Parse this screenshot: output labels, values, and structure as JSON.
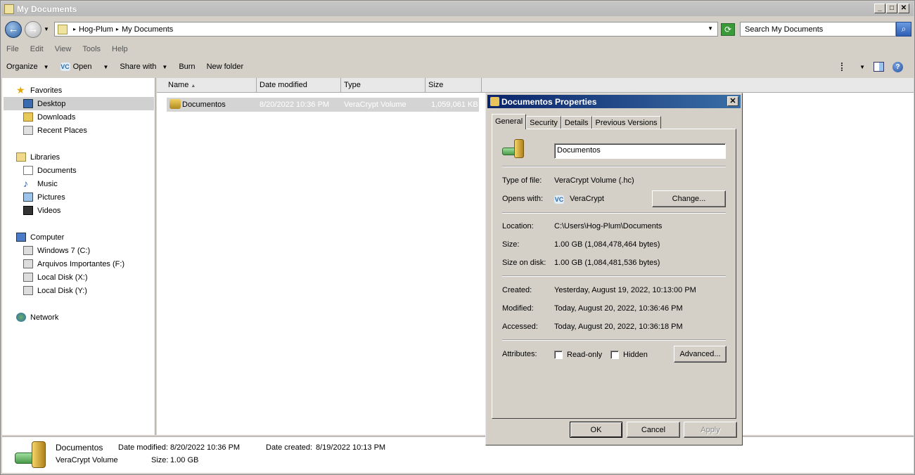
{
  "window": {
    "title": "My Documents"
  },
  "address": {
    "crumbs": [
      "Hog-Plum",
      "My Documents"
    ],
    "search_placeholder": "Search My Documents"
  },
  "menu": [
    "File",
    "Edit",
    "View",
    "Tools",
    "Help"
  ],
  "toolbar": {
    "organize": "Organize",
    "open": "Open",
    "share": "Share with",
    "burn": "Burn",
    "newfolder": "New folder"
  },
  "nav": {
    "favorites": "Favorites",
    "desktop": "Desktop",
    "downloads": "Downloads",
    "recent": "Recent Places",
    "libraries": "Libraries",
    "documents": "Documents",
    "music": "Music",
    "pictures": "Pictures",
    "videos": "Videos",
    "computer": "Computer",
    "drive_c": "Windows 7 (C:)",
    "drive_f": "Arquivos Importantes (F:)",
    "drive_x": "Local Disk (X:)",
    "drive_y": "Local Disk (Y:)",
    "network": "Network"
  },
  "columns": {
    "name": "Name",
    "date": "Date modified",
    "type": "Type",
    "size": "Size"
  },
  "file": {
    "name": "Documentos",
    "date": "8/20/2022 10:36 PM",
    "type": "VeraCrypt Volume",
    "size": "1,059,061 KB"
  },
  "status": {
    "name": "Documentos",
    "type": "VeraCrypt Volume",
    "date_modified_label": "Date modified:",
    "date_modified": "8/20/2022 10:36 PM",
    "date_created_label": "Date created:",
    "date_created": "8/19/2022 10:13 PM",
    "size_label": "Size:",
    "size": "1.00 GB"
  },
  "dialog": {
    "title": "Documentos Properties",
    "tabs": [
      "General",
      "Security",
      "Details",
      "Previous Versions"
    ],
    "name": "Documentos",
    "type_label": "Type of file:",
    "type": "VeraCrypt Volume (.hc)",
    "opens_label": "Opens with:",
    "opens": "VeraCrypt",
    "change": "Change...",
    "location_label": "Location:",
    "location": "C:\\Users\\Hog-Plum\\Documents",
    "size_label": "Size:",
    "size": "1.00 GB (1,084,478,464 bytes)",
    "disk_label": "Size on disk:",
    "disk": "1.00 GB (1,084,481,536 bytes)",
    "created_label": "Created:",
    "created": "Yesterday, August 19, 2022, 10:13:00 PM",
    "modified_label": "Modified:",
    "modified": "Today, August 20, 2022, 10:36:46 PM",
    "accessed_label": "Accessed:",
    "accessed": "Today, August 20, 2022, 10:36:18 PM",
    "attr_label": "Attributes:",
    "readonly": "Read-only",
    "hidden": "Hidden",
    "advanced": "Advanced...",
    "ok": "OK",
    "cancel": "Cancel",
    "apply": "Apply"
  },
  "colors": {
    "accent": "#0a246a",
    "selection": "#d4d4d4"
  }
}
